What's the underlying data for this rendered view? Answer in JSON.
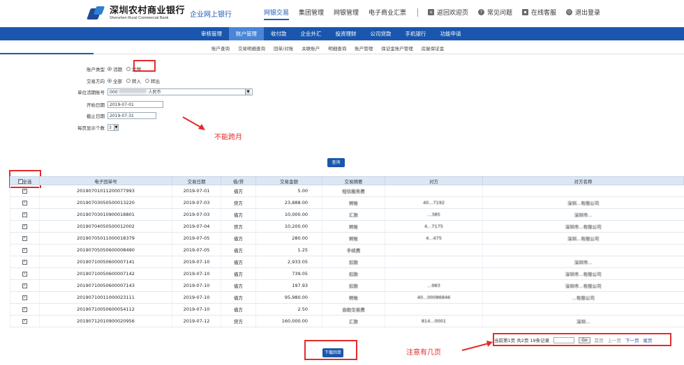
{
  "header": {
    "logo_cn": "深圳农村商业银行",
    "logo_en": "Shenzhen Rural Commercial Bank",
    "site_name": "企业网上银行",
    "top_nav": [
      "网银交易",
      "集团管理",
      "网银管理",
      "电子商业汇票"
    ],
    "util_nav": [
      {
        "label": "返回欢迎页",
        "icon": "home-icon"
      },
      {
        "label": "常见问题",
        "icon": "help-icon"
      },
      {
        "label": "在线客服",
        "icon": "chat-icon"
      },
      {
        "label": "退出登录",
        "icon": "logout-icon"
      }
    ]
  },
  "main_nav": [
    "审核管理",
    "账户管理",
    "收付款",
    "企业外汇",
    "投资理财",
    "公司贷款",
    "手机银行",
    "功能申请"
  ],
  "sub_nav": [
    "账户查询",
    "交易明细查询",
    "回单/对账",
    "关联账户",
    "明细查询",
    "账户管理",
    "保证金账户管理",
    "房屋保证金"
  ],
  "form": {
    "account_type_label": "账户类型",
    "account_type_options": [
      "活期",
      "定期"
    ],
    "direction_label": "交易方向",
    "direction_options": [
      "全部",
      "转入",
      "转出"
    ],
    "account_label": "单位活期账号",
    "account_value_prefix": "000",
    "account_value_suffix": "人民币",
    "start_label": "开始日期",
    "start_value": "2019-07-01",
    "end_label": "截止日期",
    "end_value": "2019-07-31",
    "page_size_label": "每页显示个数",
    "page_size_value": "3",
    "query_button": "查询"
  },
  "annotations": {
    "no_cross_month": "不能跨月",
    "note_pages": "注意有几页"
  },
  "table": {
    "select_all": "全选",
    "columns": [
      "电子回单号",
      "交易日期",
      "借/贷",
      "交易金额",
      "交易摘要",
      "对方",
      "对方名称"
    ],
    "rows": [
      {
        "id": "20190701011200077993",
        "date": "2019-07-01",
        "dc": "借方",
        "amount": "5.00",
        "summary": "短信服务费",
        "acct": "",
        "name": ""
      },
      {
        "id": "20190703050500013220",
        "date": "2019-07-03",
        "dc": "贷方",
        "amount": "23,888.00",
        "summary": "转账",
        "acct": "40...7192",
        "name": "深圳...有限公司"
      },
      {
        "id": "20190703010900018801",
        "date": "2019-07-03",
        "dc": "借方",
        "amount": "10,000.00",
        "summary": "汇款",
        "acct": "...385",
        "name": "深圳市..."
      },
      {
        "id": "20190704050500012002",
        "date": "2019-07-04",
        "dc": "贷方",
        "amount": "10,200.00",
        "summary": "转账",
        "acct": "4...7175",
        "name": "深圳市...有限公司"
      },
      {
        "id": "20190705011000018379",
        "date": "2019-07-05",
        "dc": "借方",
        "amount": "280.00",
        "summary": "转账",
        "acct": "4...475",
        "name": "深圳...有限公司"
      },
      {
        "id": "20190705050600008490",
        "date": "2019-07-05",
        "dc": "借方",
        "amount": "1.25",
        "summary": "手续费",
        "acct": "",
        "name": ""
      },
      {
        "id": "20190710050600007141",
        "date": "2019-07-10",
        "dc": "借方",
        "amount": "2,933.05",
        "summary": "扣款",
        "acct": "",
        "name": "深圳市..."
      },
      {
        "id": "20190710050600007142",
        "date": "2019-07-10",
        "dc": "借方",
        "amount": "739.05",
        "summary": "扣款",
        "acct": "",
        "name": "深圳市...有限公司"
      },
      {
        "id": "20190710050600007143",
        "date": "2019-07-10",
        "dc": "借方",
        "amount": "197.93",
        "summary": "扣款",
        "acct": "...983",
        "name": "深圳市...有限公司"
      },
      {
        "id": "20190710011000023111",
        "date": "2019-07-10",
        "dc": "借方",
        "amount": "95,980.00",
        "summary": "转账",
        "acct": "40...00086846",
        "name": "...有限公司"
      },
      {
        "id": "20190710050600054112",
        "date": "2019-07-10",
        "dc": "借方",
        "amount": "2.50",
        "summary": "自助交易费",
        "acct": "",
        "name": ""
      },
      {
        "id": "20190712010900020956",
        "date": "2019-07-12",
        "dc": "贷方",
        "amount": "160,000.00",
        "summary": "汇款",
        "acct": "814...0001",
        "name": "深圳..."
      }
    ]
  },
  "pager": {
    "info": "当前第1页 共2页 19条记录",
    "go": "Go",
    "first": "首页",
    "prev": "上一页",
    "next": "下一页",
    "last": "尾页"
  },
  "download_button": "下载回单"
}
